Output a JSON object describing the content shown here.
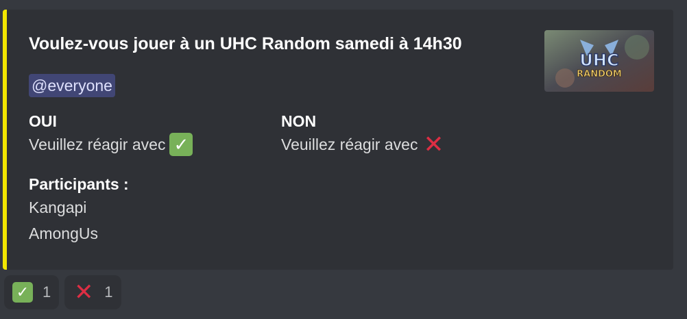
{
  "embed": {
    "accent_color": "#f2e600",
    "title": "Voulez-vous jouer à un UHC Random samedi à 14h30",
    "mention": "@everyone",
    "fields": {
      "oui": {
        "name": "OUI",
        "value": "Veuillez réagir avec",
        "emoji": "check-mark-icon"
      },
      "non": {
        "name": "NON",
        "value": "Veuillez réagir avec",
        "emoji": "cross-mark-icon"
      }
    },
    "participants": {
      "name": "Participants :",
      "list": [
        "Kangapi",
        "AmongUs"
      ]
    },
    "thumbnail": {
      "logo_text": "UHC RANDOM"
    }
  },
  "reactions": [
    {
      "emoji": "check-mark-icon",
      "count": "1"
    },
    {
      "emoji": "cross-mark-icon",
      "count": "1"
    }
  ]
}
